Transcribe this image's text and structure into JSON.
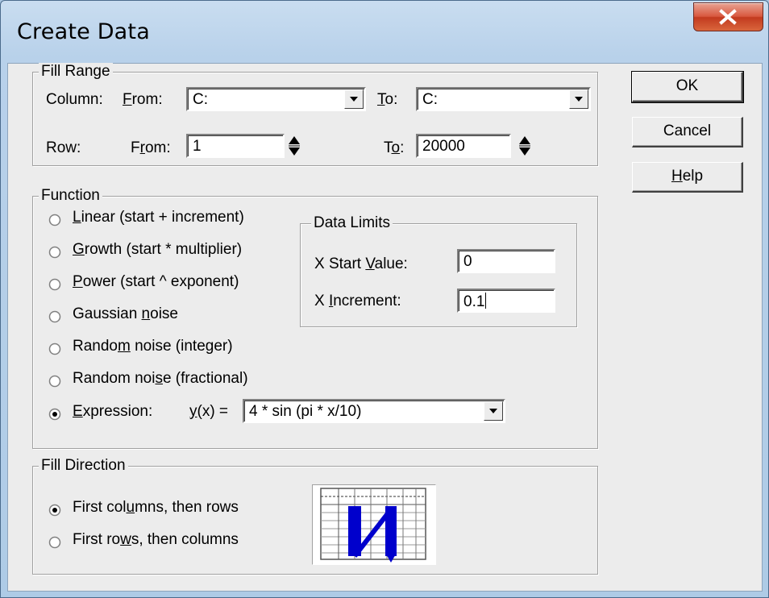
{
  "window": {
    "title": "Create Data"
  },
  "fill_range": {
    "label": "Fill Range",
    "column_label": "Column:",
    "from_label_pre": "",
    "from_label_u": "F",
    "from_label_post": "rom:",
    "column_from": "C:",
    "to_label_u": "T",
    "to_label_post": "o:",
    "column_to": "C:",
    "row_label": "Row:",
    "row_from_pre": "F",
    "row_from_u": "r",
    "row_from_post": "om:",
    "row_from": "1",
    "row_to_pre": "T",
    "row_to_u": "o",
    "row_to_post": ":",
    "row_to": "20000"
  },
  "function": {
    "label": "Function",
    "options": [
      {
        "pre": "",
        "u": "L",
        "post": "inear (start + increment)",
        "selected": false
      },
      {
        "pre": "",
        "u": "G",
        "post": "rowth (start * multiplier)",
        "selected": false
      },
      {
        "pre": "",
        "u": "P",
        "post": "ower (start ^ exponent)",
        "selected": false
      },
      {
        "pre": "Gaussian ",
        "u": "n",
        "post": "oise",
        "selected": false
      },
      {
        "pre": "Rando",
        "u": "m",
        "post": " noise (integer)",
        "selected": false
      },
      {
        "pre": "Random noi",
        "u": "s",
        "post": "e (fractional)",
        "selected": false
      },
      {
        "pre": "",
        "u": "E",
        "post": "xpression:",
        "selected": true
      }
    ],
    "yx_u": "y",
    "yx_post": "(x) =",
    "expression": "4 * sin (pi * x/10)",
    "data_limits": {
      "label": "Data Limits",
      "x_start_pre": "X Start ",
      "x_start_u": "V",
      "x_start_post": "alue:",
      "x_start_value": "0",
      "x_inc_pre": "X ",
      "x_inc_u": "I",
      "x_inc_post": "ncrement:",
      "x_inc_value": "0.1"
    }
  },
  "fill_direction": {
    "label": "Fill Direction",
    "options": [
      {
        "pre": "First col",
        "u": "u",
        "post": "mns, then rows",
        "selected": true
      },
      {
        "pre": "First ro",
        "u": "w",
        "post": "s, then columns",
        "selected": false
      }
    ]
  },
  "buttons": {
    "ok": "OK",
    "cancel": "Cancel",
    "help_u": "H",
    "help_post": "elp"
  },
  "colors": {
    "accent_blue": "#0000cc",
    "close_red": "#c23a1f"
  }
}
